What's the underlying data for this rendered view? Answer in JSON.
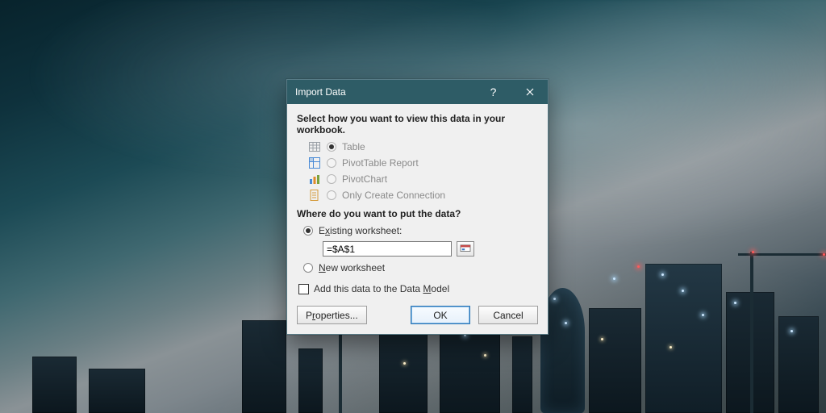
{
  "titlebar": {
    "title": "Import Data"
  },
  "section1": {
    "heading": "Select how you want to view this data in your workbook.",
    "options": {
      "table": "Table",
      "pivot_table": "PivotTable Report",
      "pivot_chart": "PivotChart",
      "connection_only": "Only Create Connection"
    }
  },
  "section2": {
    "heading": "Where do you want to put the data?",
    "existing_pre": "E",
    "existing_ul": "x",
    "existing_post": "isting worksheet:",
    "ref_value": "=$A$1",
    "new_ul": "N",
    "new_post": "ew worksheet"
  },
  "model": {
    "pre": "Add this data to the Data ",
    "ul": "M",
    "post": "odel"
  },
  "buttons": {
    "properties_pre": "P",
    "properties_ul": "r",
    "properties_post": "operties...",
    "ok": "OK",
    "cancel": "Cancel"
  },
  "colors": {
    "titlebar": "#2e5c66",
    "dialog_bg": "#f0f0f0"
  }
}
